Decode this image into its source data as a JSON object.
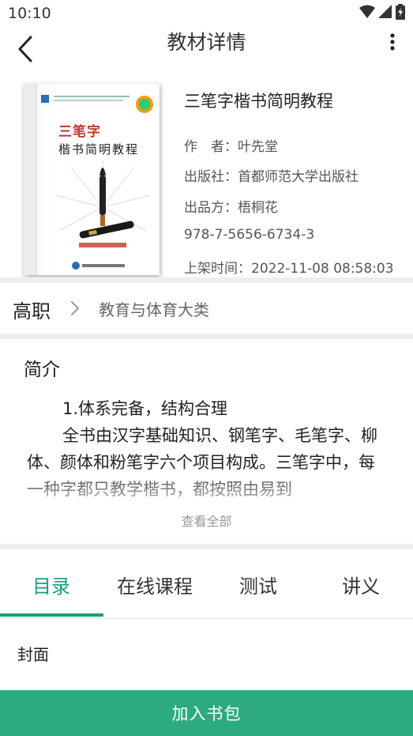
{
  "status_bar": {
    "time": "10:10"
  },
  "header": {
    "title": "教材详情"
  },
  "book": {
    "title": "三笔字楷书简明教程",
    "author_line": "作　者：叶先堂",
    "publisher_line": "出版社：首都师范大学出版社",
    "producer_line": "出品方：梧桐花",
    "isbn": "978-7-5656-6734-3",
    "shelf_time_line": "上架时间：2022-11-08 08:58:03",
    "cover": {
      "title_red": "三笔字",
      "title_black": "楷书简明教程"
    }
  },
  "breadcrumb": {
    "level": "高职",
    "category": "教育与体育大类"
  },
  "intro": {
    "heading": "简介",
    "paragraph1": "1.体系完备，结构合理",
    "paragraph2": "全书由汉字基础知识、钢笔字、毛笔字、柳体、颜体和粉笔字六个项目构成。三笔字中，每一种字都只教学楷书，都按照由易到",
    "view_all": "查看全部"
  },
  "tabs": [
    {
      "label": "目录",
      "active": true
    },
    {
      "label": "在线课程",
      "active": false
    },
    {
      "label": "测试",
      "active": false
    },
    {
      "label": "讲义",
      "active": false
    }
  ],
  "toc": {
    "first_item": "封面"
  },
  "bottom_action": {
    "label": "加入书包"
  },
  "colors": {
    "accent": "#1a9e78",
    "button": "#2eaa80",
    "divider": "#eeeeee"
  },
  "icons": [
    "wifi-icon",
    "signal-icon",
    "battery-icon",
    "back-arrow-icon",
    "more-vert-icon",
    "chevron-right-icon"
  ]
}
